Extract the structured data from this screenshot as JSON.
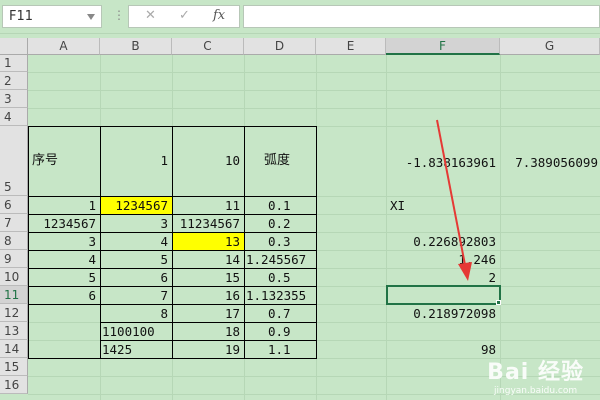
{
  "formula_bar": {
    "name_box": "F11",
    "dots": "⋮",
    "cancel_glyph": "✕",
    "enter_glyph": "✓",
    "fx_glyph": "fx",
    "formula": ""
  },
  "columns": [
    "A",
    "B",
    "C",
    "D",
    "E",
    "F",
    "G"
  ],
  "rows": [
    "1",
    "2",
    "3",
    "4",
    "5",
    "6",
    "7",
    "8",
    "9",
    "10",
    "11",
    "12",
    "13",
    "14",
    "15",
    "16"
  ],
  "cells": {
    "A5": "序号",
    "B5": "1",
    "C5": "10",
    "D5": "弧度",
    "F5": "-1.838163961",
    "G5": "7.389056099",
    "A6": "1",
    "B6": "1234567",
    "C6": "11",
    "D6": "0.1",
    "F6": "XI",
    "A7": "1234567",
    "B7": "3",
    "C7": "11234567",
    "D7": "0.2",
    "A8": "3",
    "B8": "4",
    "C8": "13",
    "D8": "0.3",
    "F8": "0.226892803",
    "A9": "4",
    "B9": "5",
    "C9": "14",
    "D9": "1.245567",
    "F9": "1.246",
    "A10": "5",
    "B10": "6",
    "C10": "15",
    "D10": "0.5",
    "F10": "2",
    "A11": "6",
    "B11": "7",
    "C11": "16",
    "D11": "1.132355",
    "B12": "8",
    "C12": "17",
    "D12": "0.7",
    "F12": "0.218972098",
    "B13": "1100100",
    "C13": "18",
    "D13": "0.9",
    "B14": "1425",
    "C14": "19",
    "D14": "1.1",
    "F14": "98"
  },
  "colors": {
    "sheet_bg": "#c7e6c7",
    "highlight": "#ffff00",
    "selection": "#217346",
    "arrow": "#e53935"
  },
  "watermark": {
    "logo": "Bai 经验",
    "url": "jingyan.baidu.com"
  }
}
